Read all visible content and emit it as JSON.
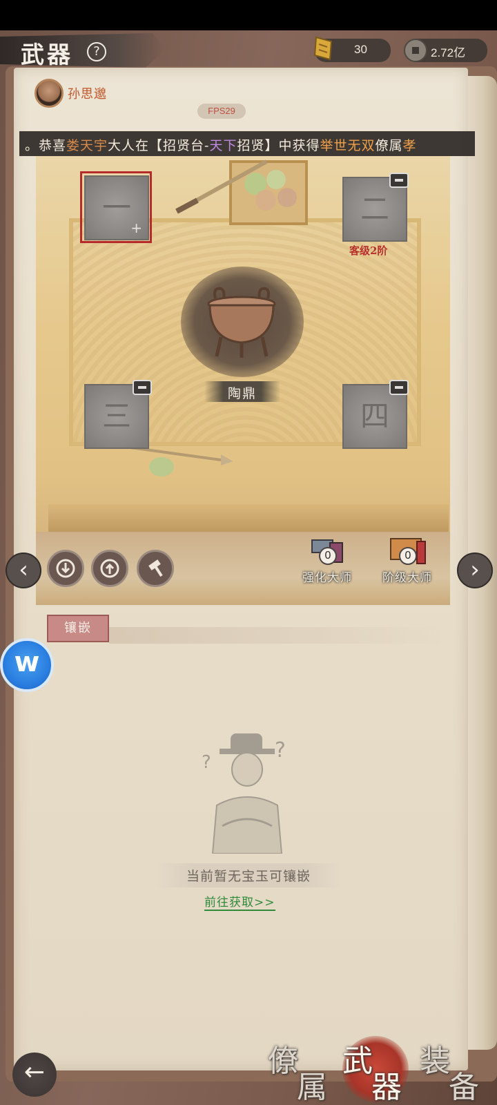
{
  "header": {
    "title": "武器",
    "help_icon": "?",
    "gold_amount": "30",
    "coin_amount": "2.72亿"
  },
  "hero": {
    "name": "孙思邈",
    "fps": "FPS29"
  },
  "ticker": {
    "prefix": "。恭喜",
    "player": "娄天宇",
    "middle1": "大人在【招贤台-",
    "pool": "天下",
    "middle2": "招贤】中获得",
    "reward": "举世无双",
    "suffix": "僚属",
    "tail": "孝"
  },
  "slots": [
    {
      "numeral": "一",
      "locked": false,
      "selected": true
    },
    {
      "numeral": "二",
      "locked": true,
      "requirement": "客级2阶"
    },
    {
      "numeral": "三",
      "locked": true
    },
    {
      "numeral": "四",
      "locked": true
    }
  ],
  "item": {
    "name": "陶鼎"
  },
  "actions": {
    "prev_icon": "‹",
    "next_icon": "›"
  },
  "masters": [
    {
      "label": "强化大师",
      "count": "0"
    },
    {
      "label": "阶级大师",
      "count": "0"
    }
  ],
  "inlay": {
    "tab_label": "镶嵌",
    "empty_text": "当前暂无宝玉可镶嵌",
    "go_link": "前往获取>>"
  },
  "float_button": {
    "glyph": "w"
  },
  "bottom_nav": {
    "back_icon": "←",
    "tabs": [
      {
        "c1": "僚",
        "c2": "属",
        "active": false
      },
      {
        "c1": "武",
        "c2": "器",
        "active": true
      },
      {
        "c1": "装",
        "c2": "备",
        "active": false
      }
    ]
  },
  "colors": {
    "accent_red": "#b52a2a",
    "link_green": "#2f8a3a",
    "name_orange": "#c4562a"
  }
}
